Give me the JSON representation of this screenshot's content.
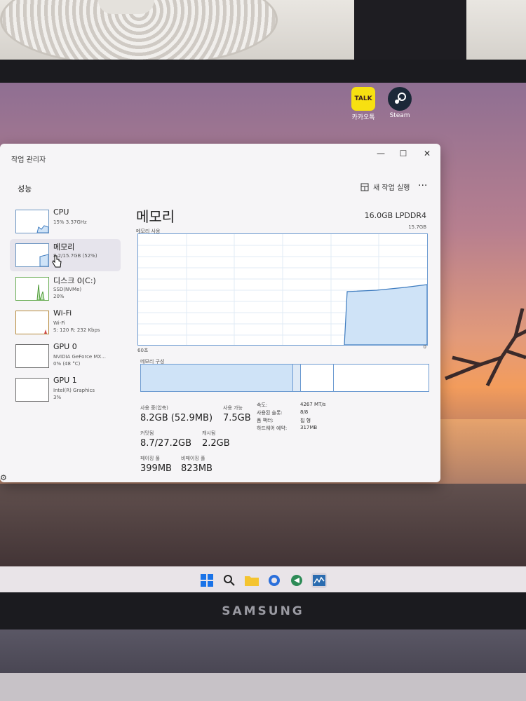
{
  "window": {
    "app_title": "작업 관리자",
    "minimize": "—",
    "maximize": "☐",
    "close": "✕"
  },
  "header": {
    "page_title": "성능",
    "run_new_task": "새 작업 실행",
    "more": "···"
  },
  "sidebar": {
    "items": [
      {
        "name": "CPU",
        "sub": "15% 3.37GHz",
        "icon": "cpu-graph"
      },
      {
        "name": "메모리",
        "sub": "8.2/15.7GB (52%)",
        "icon": "memory-graph"
      },
      {
        "name": "디스크 0(C:)",
        "sub": "SSD(NVMe)",
        "sub2": "20%",
        "icon": "disk-graph"
      },
      {
        "name": "Wi-Fi",
        "sub": "Wi-Fi",
        "sub2": "S: 120 R: 232 Kbps",
        "icon": "wifi-graph"
      },
      {
        "name": "GPU 0",
        "sub": "NVIDIA GeForce MX...",
        "sub2": "0% (48 °C)",
        "icon": "gpu-graph"
      },
      {
        "name": "GPU 1",
        "sub": "Intel(R) Graphics",
        "sub2": "3%",
        "icon": "gpu-graph"
      }
    ]
  },
  "memory": {
    "title": "메모리",
    "spec": "16.0GB LPDDR4",
    "usage_label": "메모리 사용",
    "usage_max": "15.7GB",
    "graph_left": "60초",
    "graph_right": "0",
    "composition_label": "메모리 구성",
    "in_use_fraction": 0.52,
    "stats": {
      "in_use_label": "사용 중(압축)",
      "in_use_value": "8.2GB (52.9MB)",
      "available_label": "사용 가능",
      "available_value": "7.5GB",
      "committed_label": "커밋됨",
      "committed_value": "8.7/27.2GB",
      "cached_label": "캐시됨",
      "cached_value": "2.2GB",
      "paged_label": "페이징 풀",
      "paged_value": "399MB",
      "nonpaged_label": "비페이징 풀",
      "nonpaged_value": "823MB"
    },
    "info": {
      "speed_label": "속도:",
      "speed_value": "4267 MT/s",
      "slots_label": "사용된 슬롯:",
      "slots_value": "8/8",
      "form_label": "폼 팩터:",
      "form_value": "칩 형",
      "hw_reserved_label": "하드웨어 예약:",
      "hw_reserved_value": "317MB"
    }
  },
  "desktop": {
    "icons": [
      {
        "label": "카카오톡",
        "icon": "kakaotalk-icon",
        "glyph": "TALK"
      },
      {
        "label": "Steam",
        "icon": "steam-icon"
      }
    ]
  },
  "laptop": {
    "brand": "SAMSUNG"
  },
  "colors": {
    "accent": "#6d9bd1",
    "graph_fill": "#cfe3f7"
  }
}
